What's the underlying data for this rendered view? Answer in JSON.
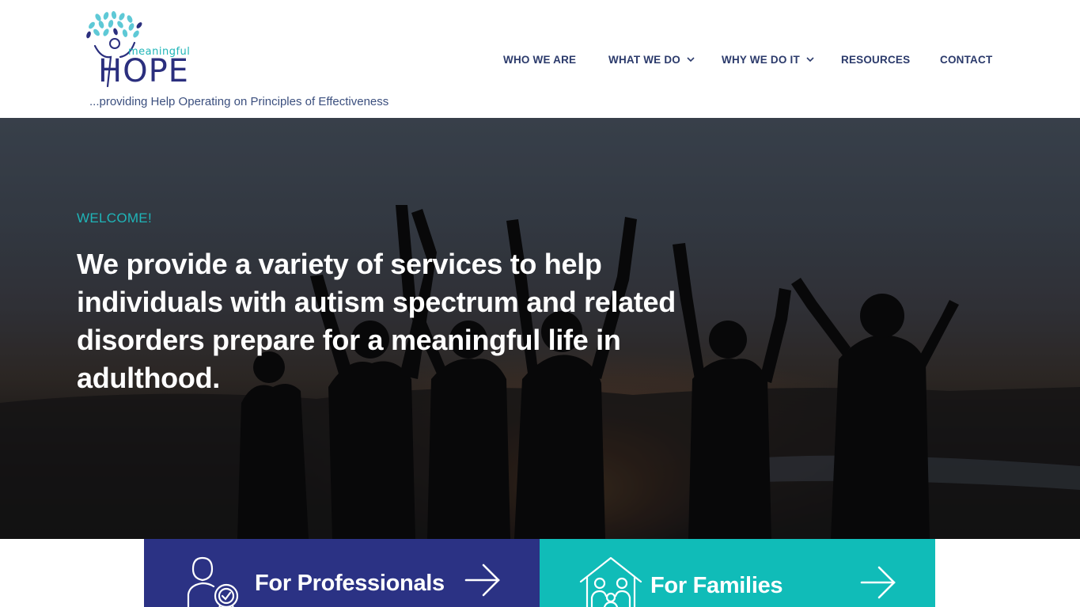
{
  "brand": {
    "logo_small": "meaningful",
    "logo_main": "HOPE",
    "tagline": "...providing Help Operating on Principles of Effectiveness"
  },
  "nav": {
    "items": [
      {
        "label": "WHO WE ARE",
        "has_dropdown": false
      },
      {
        "label": "WHAT WE DO",
        "has_dropdown": true
      },
      {
        "label": "WHY WE DO IT",
        "has_dropdown": true
      },
      {
        "label": "RESOURCES",
        "has_dropdown": false
      },
      {
        "label": "CONTACT",
        "has_dropdown": false
      }
    ]
  },
  "hero": {
    "eyebrow": "WELCOME!",
    "headline": "We provide a variety of services to help individuals with autism spectrum and related disorders prepare for a meaningful life in adulthood."
  },
  "cards": [
    {
      "label": "For Professionals",
      "icon": "professional-award-icon",
      "arrow": "arrow-right-icon",
      "color": "#2b3284"
    },
    {
      "label": "For Families",
      "icon": "family-home-icon",
      "arrow": "arrow-right-icon",
      "color": "#10bcb8"
    }
  ],
  "colors": {
    "brand_navy": "#2b2f7e",
    "brand_teal": "#1fb5b8",
    "nav_text": "#2b3a6b"
  }
}
